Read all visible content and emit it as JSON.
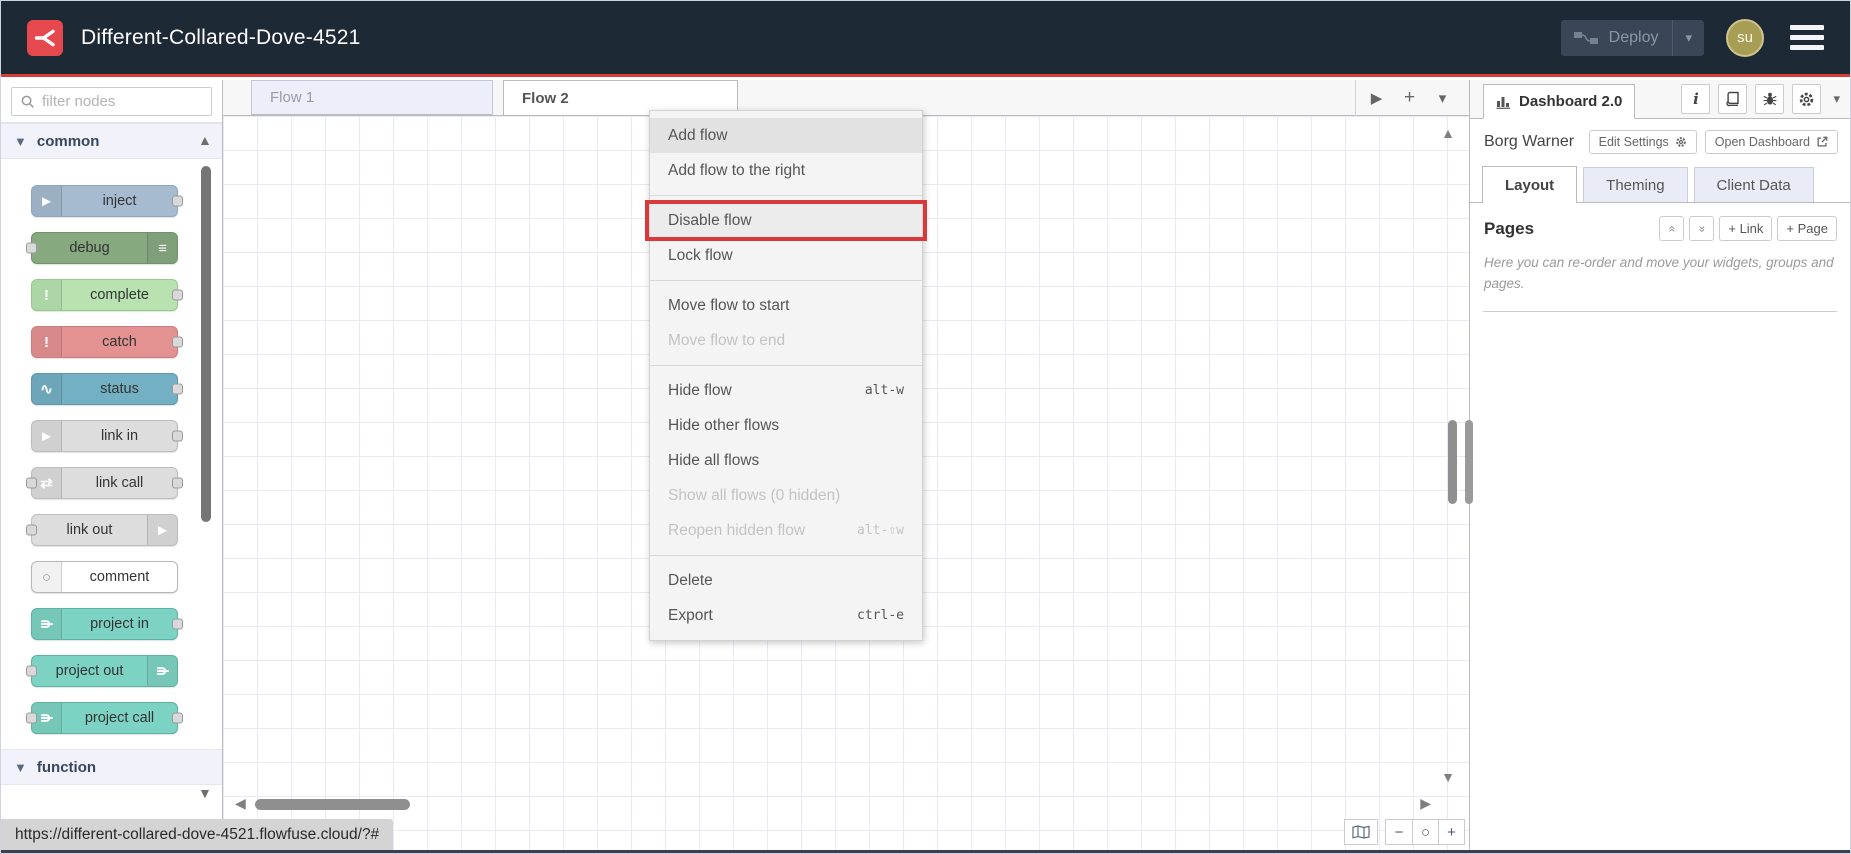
{
  "header": {
    "title": "Different-Collared-Dove-4521",
    "deploy_label": "Deploy",
    "avatar_initials": "su"
  },
  "palette": {
    "filter_placeholder": "filter nodes",
    "sections": [
      {
        "label": "common"
      },
      {
        "label": "function"
      }
    ],
    "nodes": [
      {
        "label": "inject",
        "color": "#a6bbcf",
        "border": "#8fa7bd",
        "glyph": "►"
      },
      {
        "label": "debug",
        "color": "#87a980",
        "border": "#71936a",
        "glyph": "≡"
      },
      {
        "label": "complete",
        "color": "#b8e3b0",
        "border": "#98c78f",
        "glyph": "!"
      },
      {
        "label": "catch",
        "color": "#e49191",
        "border": "#c97f7f",
        "glyph": "!"
      },
      {
        "label": "status",
        "color": "#74b0c4",
        "border": "#5e96ab",
        "glyph": "∿"
      },
      {
        "label": "link in",
        "color": "#dddddd",
        "border": "#bdbdbd",
        "glyph": "►"
      },
      {
        "label": "link call",
        "color": "#dddddd",
        "border": "#bdbdbd",
        "glyph": "⇄"
      },
      {
        "label": "link out",
        "color": "#dddddd",
        "border": "#bdbdbd",
        "glyph": "►"
      },
      {
        "label": "comment",
        "color": "#ffffff",
        "border": "#b8b8b8",
        "glyph": "○"
      },
      {
        "label": "project in",
        "color": "#7dd3c3",
        "border": "#5cb3a3",
        "glyph": "⋔"
      },
      {
        "label": "project out",
        "color": "#7dd3c3",
        "border": "#5cb3a3",
        "glyph": "⋔"
      },
      {
        "label": "project call",
        "color": "#7dd3c3",
        "border": "#5cb3a3",
        "glyph": "⋔"
      }
    ]
  },
  "tabs": {
    "items": [
      {
        "label": "Flow 1",
        "active": false
      },
      {
        "label": "Flow 2",
        "active": true
      }
    ]
  },
  "context_menu": {
    "items": [
      {
        "label": "Add flow"
      },
      {
        "label": "Add flow to the right"
      },
      {
        "label": "Disable flow"
      },
      {
        "label": "Lock flow"
      },
      {
        "label": "Move flow to start"
      },
      {
        "label": "Move flow to end",
        "disabled": true
      },
      {
        "label": "Hide flow",
        "shortcut": "alt-w"
      },
      {
        "label": "Hide other flows"
      },
      {
        "label": "Hide all flows"
      },
      {
        "label": "Show all flows (0 hidden)",
        "disabled": true
      },
      {
        "label": "Reopen hidden flow",
        "shortcut": "alt-⇧w",
        "disabled": true
      },
      {
        "label": "Delete"
      },
      {
        "label": "Export",
        "shortcut": "ctrl-e"
      }
    ]
  },
  "sidebar": {
    "tab_label": "Dashboard 2.0",
    "instance_name": "Borg Warner",
    "edit_settings_label": "Edit Settings",
    "open_dashboard_label": "Open Dashboard",
    "tabs": [
      {
        "label": "Layout",
        "active": true
      },
      {
        "label": "Theming",
        "active": false
      },
      {
        "label": "Client Data",
        "active": false
      }
    ],
    "pages": {
      "title": "Pages",
      "add_link_label": "+ Link",
      "add_page_label": "+ Page",
      "help": "Here you can re-order and move your widgets, groups and pages."
    }
  },
  "status_bar": {
    "url": "https://different-collared-dove-4521.flowfuse.cloud/?#"
  },
  "view_controls": {
    "zoom_out": "−",
    "zoom_reset": "○",
    "zoom_in": "+"
  },
  "icons": {
    "logo": "flowfuse-split",
    "search": "magnifier",
    "deploy": "wired-nodes",
    "hamburger": "menu-bars",
    "dashboard_tab": "bar-chart",
    "sidebar_tools": [
      "info",
      "book",
      "bug",
      "gear"
    ],
    "caret": "▾",
    "tab_scroll_right": "▶",
    "scroll_arrows": [
      "▲",
      "▼",
      "◀",
      "▶"
    ],
    "pages_collapse": "«",
    "pages_expand": "»",
    "external_link": "arrow-out-of-box",
    "navigator": "map"
  }
}
